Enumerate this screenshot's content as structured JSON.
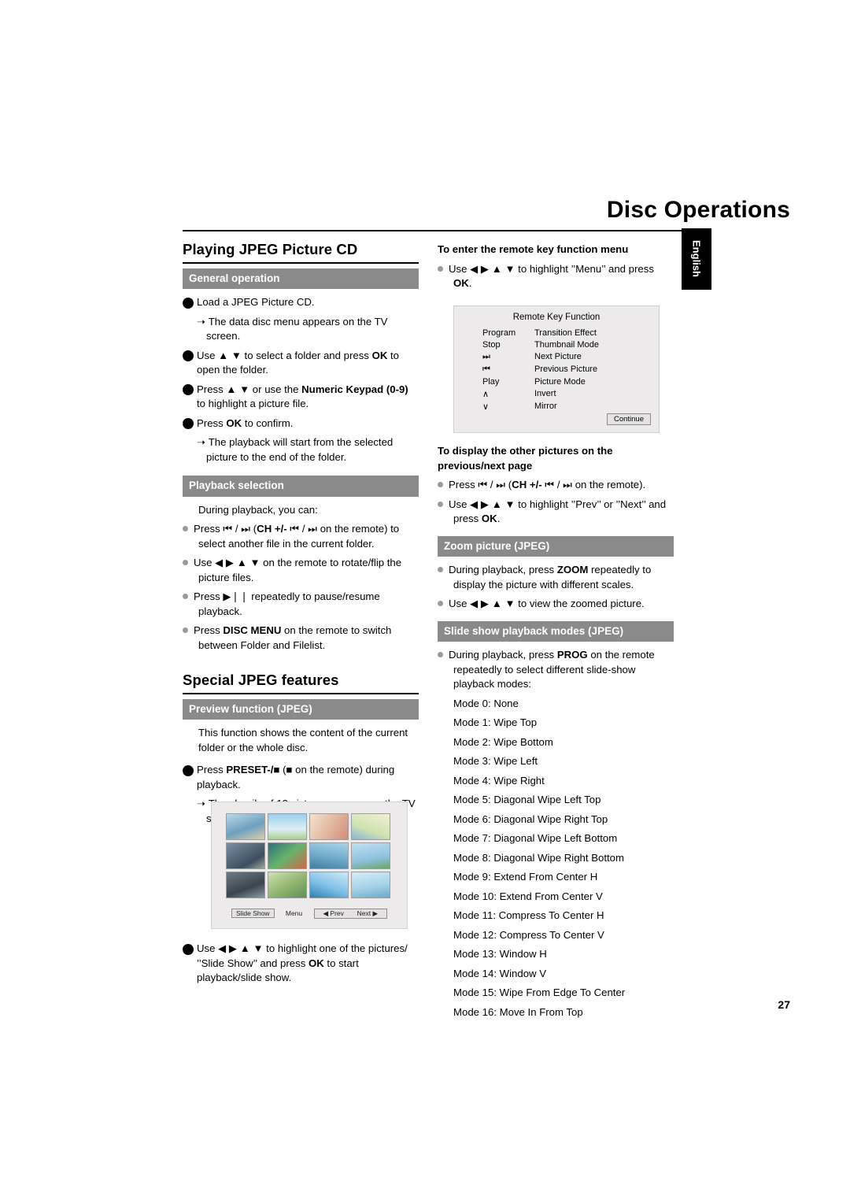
{
  "header": {
    "title": "Disc Operations",
    "language_tab": "English",
    "page_number": "27"
  },
  "left": {
    "section1_title": "Playing JPEG Picture CD",
    "bar_general": "General operation",
    "step1": "Load a JPEG Picture CD.",
    "step1_note": "The data disc menu appears on the TV screen.",
    "step2": "Use ▲ ▼ to select a folder and press OK to open the folder.",
    "step3": "Press ▲ ▼ or use the Numeric Keypad (0-9) to highlight a picture file.",
    "step4": "Press OK to confirm.",
    "step4_note": "The playback will start from the selected picture to the end of the folder.",
    "bar_playback": "Playback selection",
    "playback_intro": "During playback, you can:",
    "pb1": "Press ⏮ / ⏭ (CH +/- ⏮ / ⏭ on the remote) to select another file in the current folder.",
    "pb2": "Use ◀ ▶ ▲ ▼ on the remote to rotate/flip the picture files.",
    "pb3": "Press ▶❘❘ repeatedly to pause/resume playback.",
    "pb4": "Press DISC MENU on the remote to switch between Folder and Filelist.",
    "section2_title": "Special JPEG features",
    "bar_preview": "Preview function (JPEG)",
    "preview_intro": "This function shows the content of the current folder or the whole disc.",
    "pv_step1": "Press PRESET-/■ (■ on the remote) during playback.",
    "pv_step1_note": "Thumbnails of 12 pictures appears on the TV screen.",
    "pv_step2": "Use ◀ ▶ ▲ ▼ to highlight one of the pictures/ ’’Slide Show’’ and press OK to start playback/slide show.",
    "thumb_menu": {
      "slide_show": "Slide Show",
      "menu": "Menu",
      "prev": "◀ Prev",
      "next": "Next ▶"
    }
  },
  "right": {
    "head_remote": "To enter the remote key function menu",
    "remote_line": "Use ◀ ▶ ▲ ▼ to highlight ’’Menu’’ and press OK.",
    "rkf": {
      "title": "Remote Key Function",
      "rows": [
        {
          "key": "Program",
          "fn": "Transition Effect"
        },
        {
          "key": "Stop",
          "fn": "Thumbnail Mode"
        },
        {
          "key": "⏭",
          "fn": "Next Picture"
        },
        {
          "key": "⏮",
          "fn": "Previous Picture"
        },
        {
          "key": "Play",
          "fn": "Picture Mode"
        },
        {
          "key": "∧",
          "fn": "Invert"
        },
        {
          "key": "∨",
          "fn": "Mirror"
        }
      ],
      "continue_button": "Continue"
    },
    "head_pages": "To display the other pictures on the previous/next page",
    "pg1": "Press ⏮ / ⏭ (CH +/- ⏮ / ⏭ on the remote).",
    "pg2": "Use ◀ ▶ ▲ ▼ to highlight ’’Prev’’ or ’’Next’’ and press OK.",
    "bar_zoom": "Zoom picture (JPEG)",
    "zm1": "During playback, press ZOOM repeatedly to display the picture with different scales.",
    "zm2": "Use ◀ ▶ ▲ ▼ to view the zoomed picture.",
    "bar_slide": "Slide show playback modes (JPEG)",
    "ss_intro": "During playback, press PROG on the remote repeatedly to select different slide-show playback modes:",
    "modes": [
      "Mode 0: None",
      "Mode 1: Wipe Top",
      "Mode 2: Wipe Bottom",
      "Mode 3: Wipe Left",
      "Mode 4: Wipe Right",
      "Mode 5: Diagonal Wipe Left Top",
      "Mode 6: Diagonal Wipe Right Top",
      "Mode 7: Diagonal Wipe Left Bottom",
      "Mode 8: Diagonal Wipe Right Bottom",
      "Mode 9: Extend From Center H",
      "Mode 10: Extend From Center V",
      "Mode 11: Compress To Center H",
      "Mode 12: Compress To Center V",
      "Mode 13: Window H",
      "Mode 14: Window V",
      "Mode 15: Wipe From Edge To Center",
      "Mode 16: Move In From Top"
    ]
  }
}
